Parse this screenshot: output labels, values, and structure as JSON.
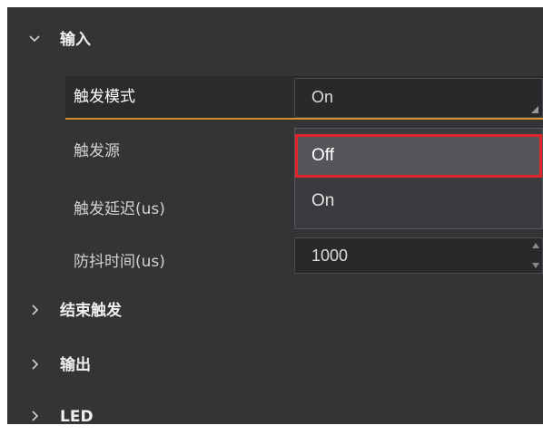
{
  "colors": {
    "panel_bg": "#333436",
    "field_bg": "#28292b",
    "accent_orange": "#d98b2b",
    "highlight_red": "#e1252a"
  },
  "sections": {
    "input": {
      "label": "输入",
      "expanded": true,
      "icon": "chevron-down-icon"
    },
    "end_trigger": {
      "label": "结束触发",
      "expanded": false,
      "icon": "chevron-right-icon"
    },
    "output": {
      "label": "输出",
      "expanded": false,
      "icon": "chevron-right-icon"
    },
    "led": {
      "label": "LED",
      "expanded": false,
      "icon": "chevron-right-icon"
    }
  },
  "properties": {
    "trigger_mode": {
      "label": "触发模式",
      "value": "On"
    },
    "trigger_source": {
      "label": "触发源"
    },
    "trigger_delay": {
      "label": "触发延迟(us)"
    },
    "debounce_time": {
      "label": "防抖时间(us)",
      "value": "1000"
    }
  },
  "dropdown": {
    "options": [
      {
        "label": "Off",
        "highlighted": true
      },
      {
        "label": "On",
        "highlighted": false
      }
    ]
  }
}
